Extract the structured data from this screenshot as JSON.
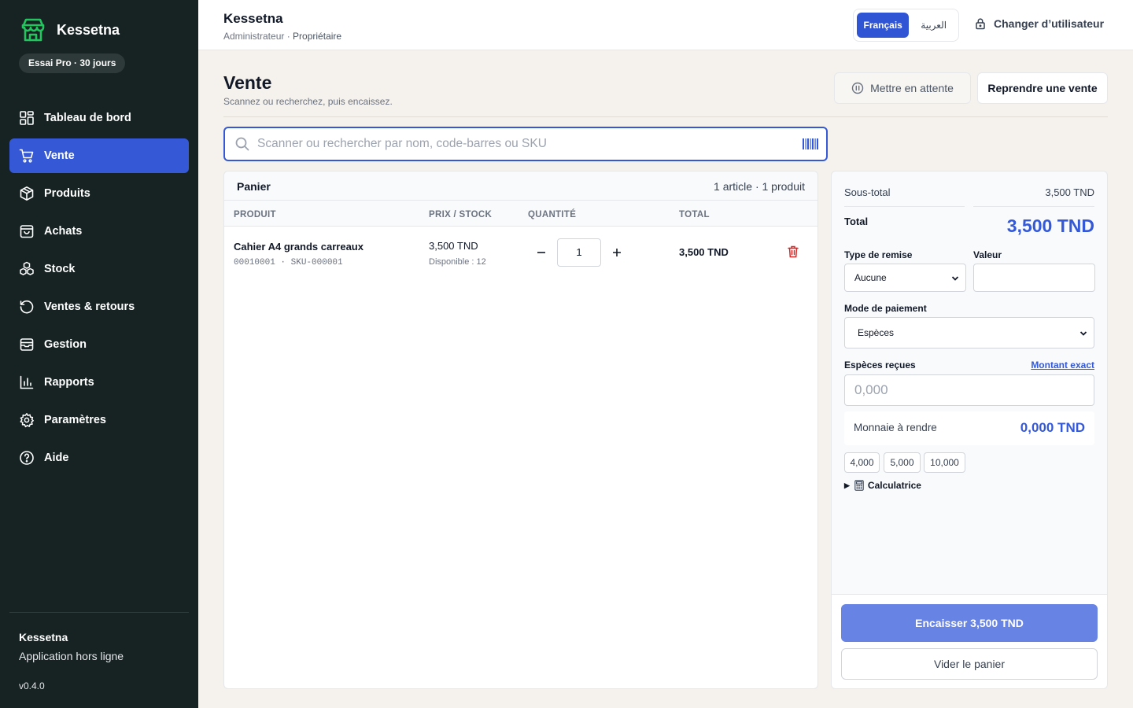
{
  "brand": {
    "name": "Kessetna",
    "trial": "Essai Pro · 30 jours"
  },
  "nav": [
    {
      "label": "Tableau de bord",
      "icon": "dashboard-icon"
    },
    {
      "label": "Vente",
      "icon": "cart-icon",
      "active": true
    },
    {
      "label": "Produits",
      "icon": "box-icon"
    },
    {
      "label": "Achats",
      "icon": "shopping-bag-icon"
    },
    {
      "label": "Stock",
      "icon": "boxes-icon"
    },
    {
      "label": "Ventes & retours",
      "icon": "history-icon"
    },
    {
      "label": "Gestion",
      "icon": "archive-icon"
    },
    {
      "label": "Rapports",
      "icon": "bar-chart-icon"
    },
    {
      "label": "Paramètres",
      "icon": "gear-icon"
    },
    {
      "label": "Aide",
      "icon": "help-icon"
    }
  ],
  "sidebar_footer": {
    "name": "Kessetna",
    "subtitle": "Application hors ligne",
    "version": "v0.4.0"
  },
  "topbar": {
    "title": "Kessetna",
    "role": "Administrateur",
    "role_sep": " · ",
    "owner": "Propriétaire",
    "lang_fr": "Français",
    "lang_ar": "العربية",
    "switch_user": "Changer d’utilisateur"
  },
  "page": {
    "title": "Vente",
    "subtitle": "Scannez ou recherchez, puis encaissez.",
    "hold_button": "Mettre en attente",
    "resume_button": "Reprendre une vente"
  },
  "search": {
    "placeholder": "Scanner ou rechercher par nom, code-barres ou SKU"
  },
  "cart": {
    "title": "Panier",
    "count": "1 article · 1 produit",
    "columns": {
      "product": "PRODUIT",
      "price": "PRIX / STOCK",
      "qty": "QUANTITÉ",
      "total": "TOTAL"
    },
    "items": [
      {
        "name": "Cahier A4 grands carreaux",
        "code": "00010001 · SKU-000001",
        "price": "3,500 TND",
        "stock": "Disponible : 12",
        "qty": "1",
        "total": "3,500 TND"
      }
    ]
  },
  "checkout": {
    "subtotal_label": "Sous-total",
    "subtotal_value": "3,500 TND",
    "total_label": "Total",
    "total_value": "3,500 TND",
    "discount_type_label": "Type de remise",
    "discount_type_value": "Aucune",
    "discount_value_label": "Valeur",
    "payment_label": "Mode de paiement",
    "payment_value": "Espèces",
    "cash_label": "Espèces reçues",
    "exact_link": "Montant exact",
    "cash_placeholder": "0,000",
    "change_label": "Monnaie à rendre",
    "change_value": "0,000 TND",
    "quick_amounts": [
      "4,000",
      "5,000",
      "10,000"
    ],
    "calculator": "Calculatrice",
    "pay_button": "Encaisser 3,500 TND",
    "clear_button": "Vider le panier"
  },
  "colors": {
    "sidebar": "#172323",
    "accent": "#3559d6",
    "brand_green": "#22c55e",
    "delete_red": "#dc2626",
    "pay_button": "#6783e3"
  }
}
